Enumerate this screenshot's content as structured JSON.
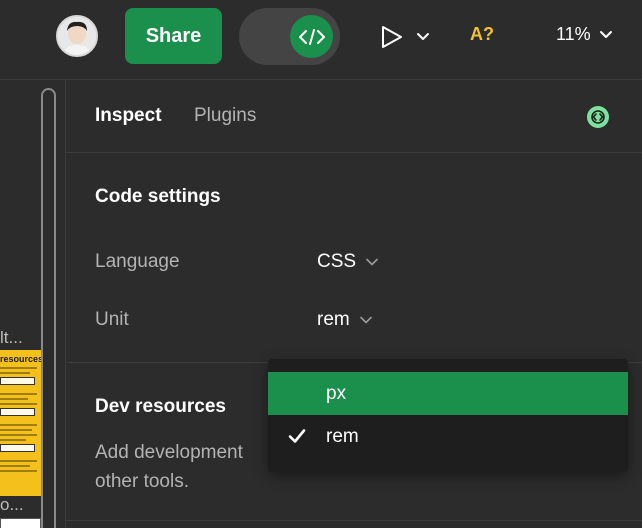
{
  "toolbar": {
    "share_label": "Share",
    "a11y_label": "A?",
    "zoom_label": "11%"
  },
  "canvas": {
    "partial_text_1": "lt...",
    "card_heading": "resources",
    "partial_text_2": "o..."
  },
  "panel": {
    "tabs": [
      {
        "label": "Inspect",
        "active": true
      },
      {
        "label": "Plugins",
        "active": false
      }
    ],
    "code_settings": {
      "title": "Code settings",
      "language_label": "Language",
      "language_value": "CSS",
      "unit_label": "Unit",
      "unit_value": "rem"
    },
    "dev_resources": {
      "title": "Dev resources",
      "description_line1": "Add development",
      "description_line2": "other tools."
    }
  },
  "unit_dropdown": {
    "options": [
      {
        "label": "px",
        "highlighted": true,
        "checked": false
      },
      {
        "label": "rem",
        "highlighted": false,
        "checked": true
      }
    ]
  },
  "colors": {
    "accent_green": "#1b8f4c",
    "a11y_yellow": "#f2c230",
    "panel_bg": "#2c2c2c",
    "dropdown_bg": "#1e1e1e"
  }
}
